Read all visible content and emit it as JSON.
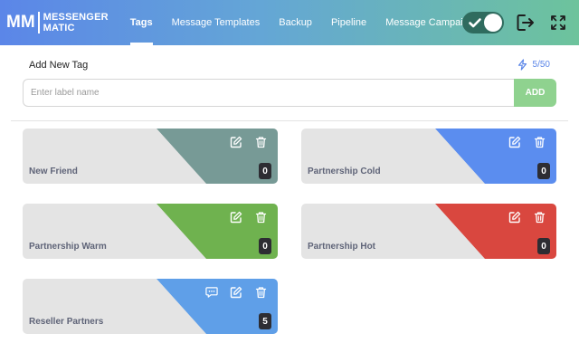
{
  "header": {
    "logo_mark": "MM",
    "logo_line1": "MESSENGER",
    "logo_line2": "MATIC",
    "tabs": [
      {
        "label": "Tags",
        "active": true
      },
      {
        "label": "Message Templates",
        "active": false
      },
      {
        "label": "Backup",
        "active": false
      },
      {
        "label": "Pipeline",
        "active": false
      },
      {
        "label": "Message Campaigns",
        "active": false
      }
    ],
    "toggle_on": true,
    "icons": [
      "check-icon",
      "logout-icon",
      "fullscreen-icon"
    ]
  },
  "add_tag": {
    "title": "Add New Tag",
    "count": "5/50",
    "placeholder": "Enter label name",
    "value": "",
    "button_label": "ADD"
  },
  "tags": [
    {
      "name": "New Friend",
      "color": "#779a96",
      "count": "0",
      "has_chat": false
    },
    {
      "name": "Partnership Cold",
      "color": "#5b8def",
      "count": "0",
      "has_chat": false
    },
    {
      "name": "Partnership Warm",
      "color": "#6fb24f",
      "count": "0",
      "has_chat": false
    },
    {
      "name": "Partnership Hot",
      "color": "#d9473f",
      "count": "0",
      "has_chat": false
    },
    {
      "name": "Reseller Partners",
      "color": "#5f9fe8",
      "count": "5",
      "has_chat": true
    }
  ],
  "colors": {
    "header_start": "#5b86e8",
    "header_end": "#6dc39c",
    "add_button": "#8fd28f",
    "card_bg": "#e4e4e4",
    "badge": "#2d2d33"
  }
}
